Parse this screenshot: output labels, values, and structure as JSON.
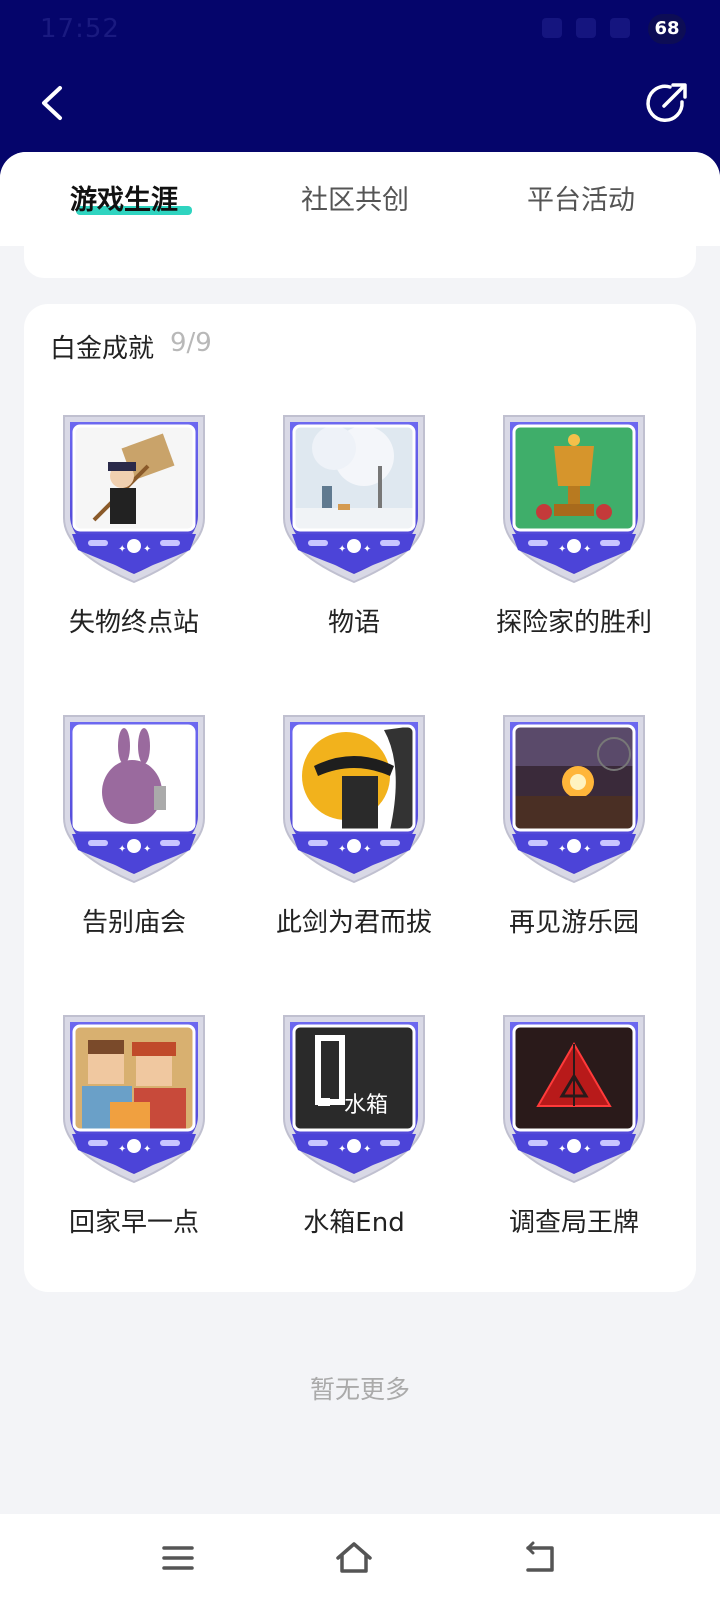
{
  "status_bar": {
    "time": "17:52",
    "battery": "68"
  },
  "header": {
    "back_icon": "chevron-left-icon",
    "share_icon": "share-icon"
  },
  "tabs": [
    {
      "label": "游戏生涯",
      "active": true
    },
    {
      "label": "社区共创",
      "active": false
    },
    {
      "label": "平台活动",
      "active": false
    }
  ],
  "section": {
    "title": "白金成就",
    "count": "9/9"
  },
  "badges": [
    {
      "label": "失物终点站",
      "art": "boy-with-sign"
    },
    {
      "label": "物语",
      "art": "snow-tree"
    },
    {
      "label": "探险家的胜利",
      "art": "golden-trophy"
    },
    {
      "label": "告别庙会",
      "art": "purple-rabbit"
    },
    {
      "label": "此剑为君而拔",
      "art": "swordsman-sun"
    },
    {
      "label": "再见游乐园",
      "art": "amusement-park-sunset"
    },
    {
      "label": "回家早一点",
      "art": "pixel-family"
    },
    {
      "label": "水箱End",
      "art": "water-tank-logo"
    },
    {
      "label": "调查局王牌",
      "art": "red-triangle"
    }
  ],
  "footer": {
    "no_more": "暂无更多"
  },
  "nav": {
    "menu_icon": "menu-icon",
    "home_icon": "home-icon",
    "back_icon": "back-icon"
  },
  "colors": {
    "header_bg": "#05056b",
    "accent": "#2fd4c0",
    "shield": "#5a54e0"
  }
}
